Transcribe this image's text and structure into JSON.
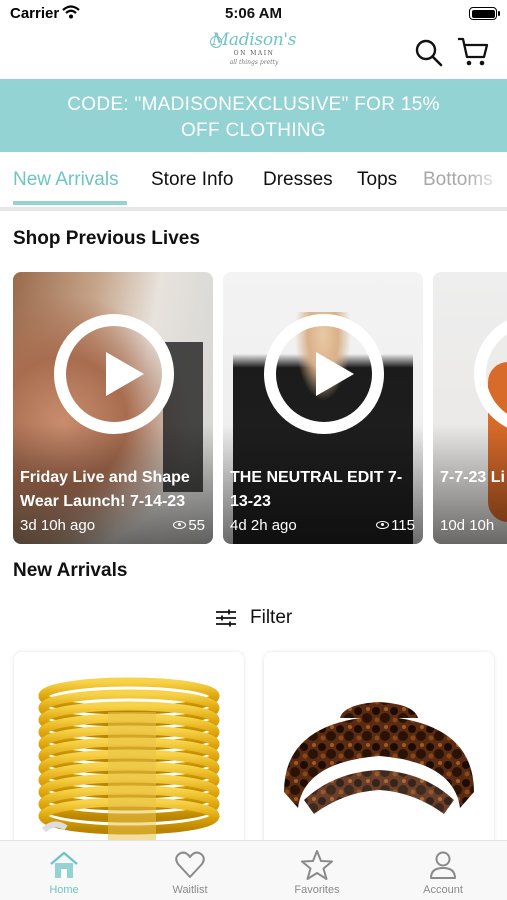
{
  "status_bar": {
    "carrier": "Carrier",
    "time": "5:06 AM"
  },
  "header": {
    "logo": {
      "title": "Madison's",
      "subtitle": "ON MAIN",
      "tagline": "all things pretty"
    },
    "icons": [
      "search-icon",
      "cart-icon"
    ]
  },
  "promo": {
    "line1": "CODE: \"MADISONEXCLUSIVE\" FOR 15%",
    "line2": "OFF CLOTHING"
  },
  "tabs": [
    {
      "label": "New Arrivals",
      "active": true
    },
    {
      "label": "Store Info",
      "active": false
    },
    {
      "label": "Dresses",
      "active": false
    },
    {
      "label": "Tops",
      "active": false
    },
    {
      "label": "Bottoms",
      "active": false
    }
  ],
  "lives": {
    "title": "Shop Previous Lives",
    "items": [
      {
        "title": "Friday Live and Shape Wear Launch! 7-14-23",
        "ago": "3d 10h ago",
        "views": "55"
      },
      {
        "title": "THE NEUTRAL EDIT 7-13-23",
        "ago": "4d 2h ago",
        "views": "115"
      },
      {
        "title": "7-7-23 Li",
        "ago": "10d 10h",
        "views": ""
      }
    ]
  },
  "arrivals": {
    "title": "New Arrivals",
    "filter_label": "Filter"
  },
  "products": [
    {
      "name": "gold bangle bracelet set"
    },
    {
      "name": "tortoiseshell claw clip"
    }
  ],
  "bottom_nav": [
    {
      "label": "Home",
      "icon": "home-icon",
      "active": true
    },
    {
      "label": "Waitlist",
      "icon": "heart-icon",
      "active": false
    },
    {
      "label": "Favorites",
      "icon": "star-icon",
      "active": false
    },
    {
      "label": "Account",
      "icon": "person-icon",
      "active": false
    }
  ],
  "colors": {
    "accent": "#94d3d3",
    "accent_text": "#6fc4c6",
    "nav_inactive": "#8a8a8a"
  }
}
